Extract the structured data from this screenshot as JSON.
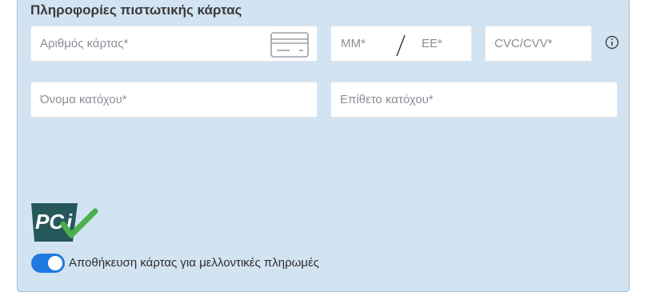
{
  "section": {
    "title": "Πληροφορίες πιστωτικής κάρτας"
  },
  "card_number": {
    "placeholder": "Αριθμός κάρτας*",
    "icon": "credit-card-icon"
  },
  "expiry": {
    "month_placeholder": "MM*",
    "separator": "/",
    "year_placeholder": "EE*"
  },
  "cvc": {
    "placeholder": "CVC/CVV*",
    "info_icon": "info-icon"
  },
  "first_name": {
    "placeholder": "Όνομα κατόχου*"
  },
  "last_name": {
    "placeholder": "Επίθετο κατόχου*"
  },
  "pci": {
    "logo_text": "PCI",
    "icon": "pci-compliance-logo"
  },
  "save_card": {
    "label": "Αποθήκευση κάρτας για μελλοντικές πληρωμές",
    "enabled": true
  },
  "colors": {
    "panel_bg": "#d2e3f2",
    "accent": "#1f7ae0",
    "pci_green": "#4cae4f",
    "pci_dark": "#26585b"
  }
}
